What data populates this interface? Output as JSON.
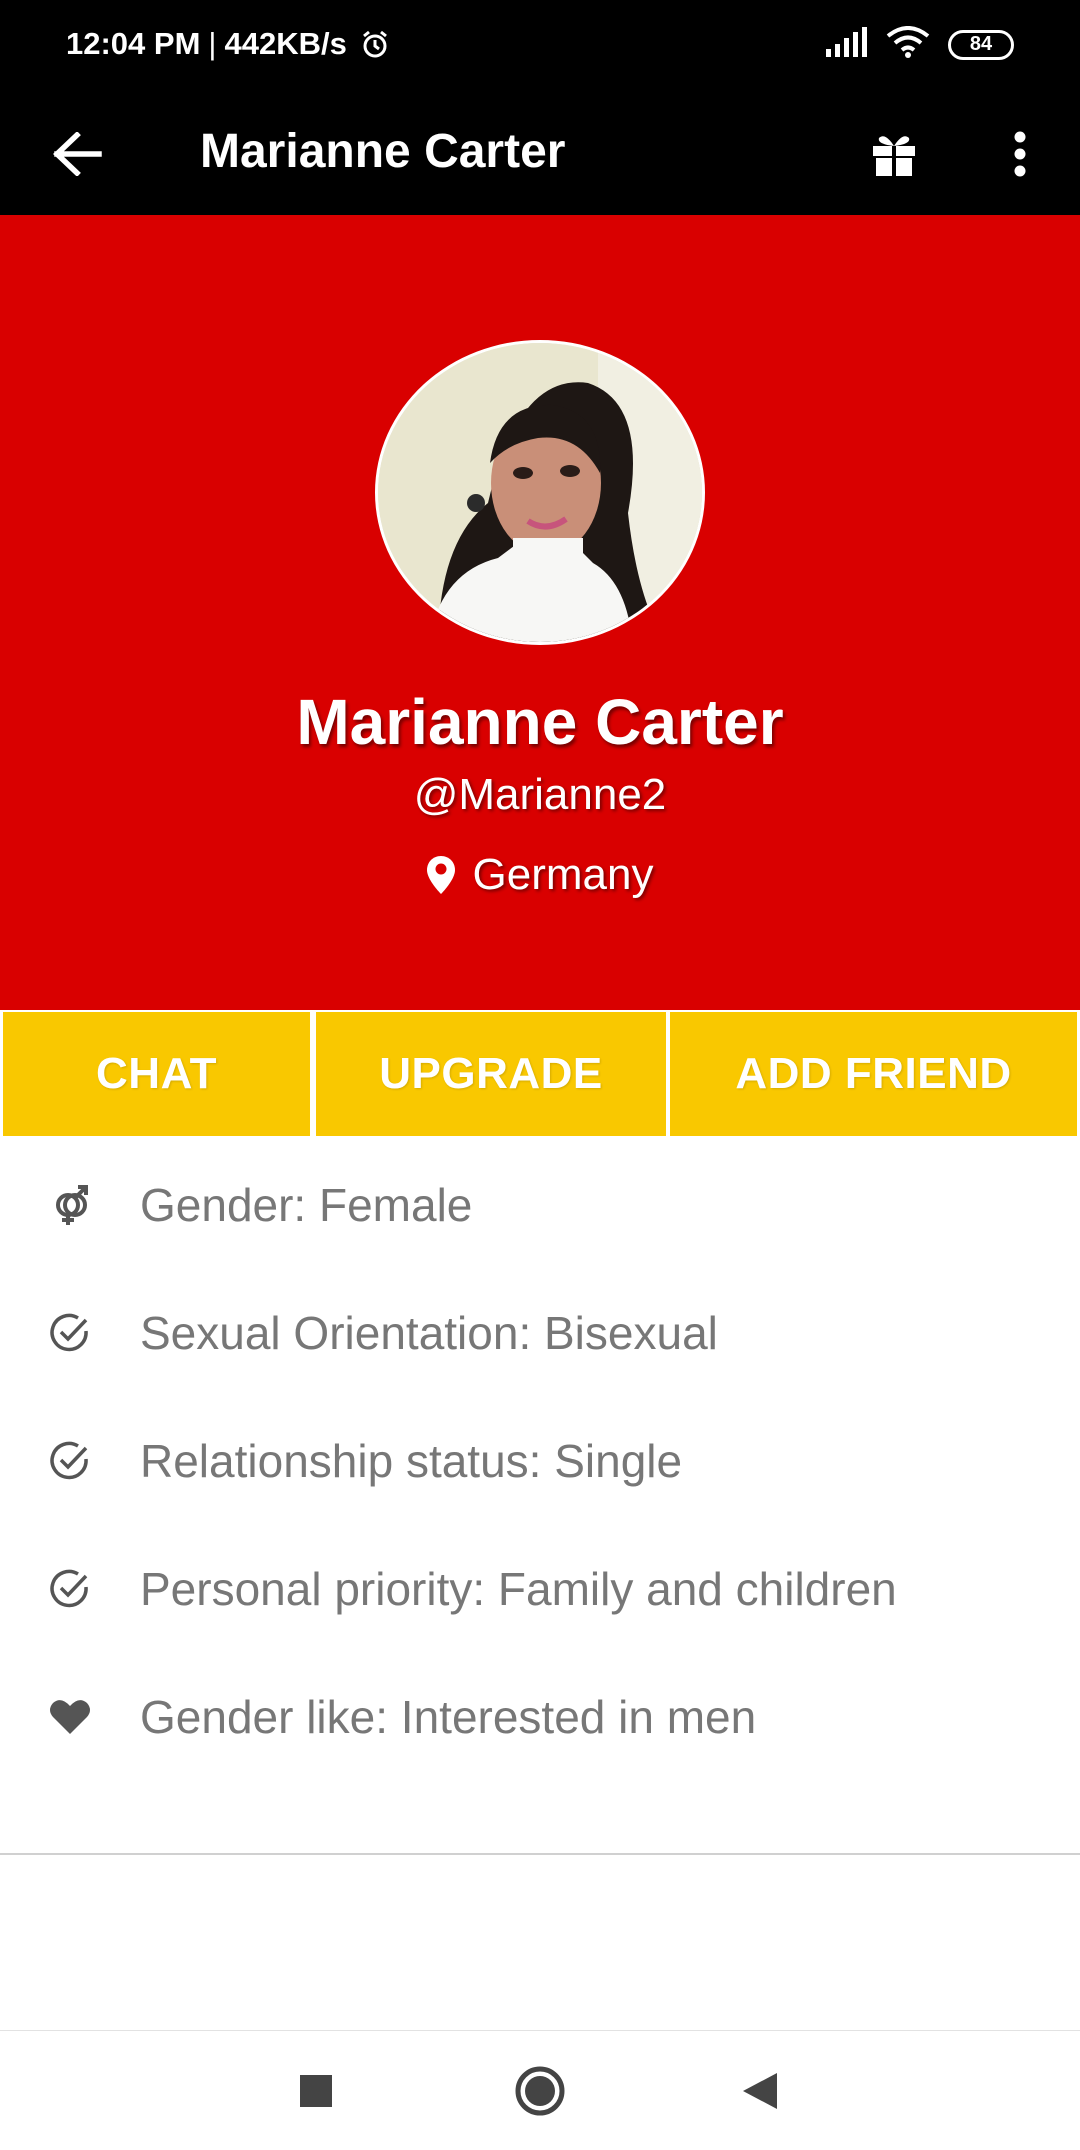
{
  "status_bar": {
    "time": "12:04 PM",
    "separator": "|",
    "speed": "442KB/s",
    "battery": "84",
    "icons": [
      "alarm-icon",
      "signal-icon",
      "wifi-icon",
      "battery-icon"
    ]
  },
  "app_bar": {
    "title": "Marianne Carter",
    "icons": [
      "back-arrow-icon",
      "gift-icon",
      "more-vert-icon"
    ]
  },
  "profile": {
    "name": "Marianne Carter",
    "handle": "@Marianne2",
    "location": "Germany",
    "colors": {
      "hero_bg": "#d90000",
      "action_bg": "#f9c800"
    }
  },
  "actions": {
    "chat": "CHAT",
    "upgrade": "UPGRADE",
    "add_friend": "ADD FRIEND"
  },
  "info": [
    {
      "icon": "gender-icon",
      "text": "Gender: Female"
    },
    {
      "icon": "check-circle-icon",
      "text": "Sexual Orientation: Bisexual"
    },
    {
      "icon": "check-circle-icon",
      "text": "Relationship status: Single"
    },
    {
      "icon": "check-circle-icon",
      "text": "Personal priority: Family and children"
    },
    {
      "icon": "heart-icon",
      "text": "Gender like: Interested in men"
    }
  ],
  "nav_bar": {
    "icons": [
      "recents-square-icon",
      "home-circle-icon",
      "back-triangle-icon"
    ]
  }
}
